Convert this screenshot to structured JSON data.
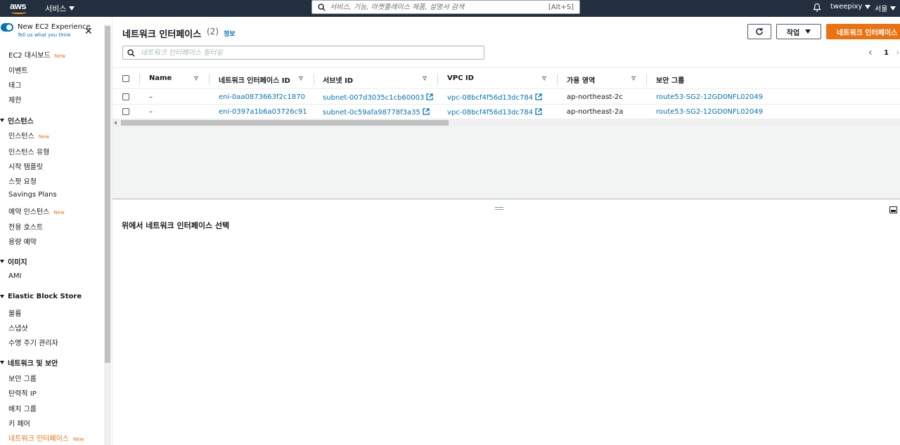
{
  "topnav": {
    "logo": "aws",
    "services_label": "서비스",
    "search_placeholder": "서비스, 기능, 마켓플레이스 제품, 설명서 검색",
    "search_shortcut": "[Alt+S]",
    "user": "tweepixy",
    "region": "서울"
  },
  "sidebar": {
    "experience_title": "New EC2 Experience",
    "experience_sub": "Tell us what you think",
    "new_badge": "New",
    "items": [
      {
        "label": "EC2 대시보드",
        "new": true
      },
      {
        "label": "이벤트"
      },
      {
        "label": "태그"
      },
      {
        "label": "제한"
      }
    ],
    "sections": {
      "instances": {
        "title": "인스턴스",
        "items": [
          "인스턴스",
          "인스턴스 유형",
          "시작 템플릿",
          "스팟 요청",
          "Savings Plans",
          "예약 인스턴스",
          "전용 호스트",
          "용량 예약"
        ]
      },
      "images": {
        "title": "이미지",
        "items": [
          "AMI"
        ]
      },
      "ebs": {
        "title": "Elastic Block Store",
        "items": [
          "볼륨",
          "스냅샷",
          "수명 주기 관리자"
        ]
      },
      "network": {
        "title": "네트워크 및 보안",
        "items": [
          "보안 그룹",
          "탄력적 IP",
          "배치 그룹",
          "키 페어",
          "네트워크 인터페이스"
        ]
      }
    }
  },
  "main": {
    "title": "네트워크 인터페이스",
    "count": "(2)",
    "info": "정보",
    "actions_label": "작업",
    "create_label": "네트워크 인터페이스 생성",
    "filter_placeholder": "네트워크 인터페이스 필터링",
    "page": "1",
    "columns": [
      "Name",
      "네트워크 인터페이스 ID",
      "서브넷 ID",
      "VPC ID",
      "가용 영역",
      "보안 그룹"
    ],
    "rows": [
      {
        "name": "–",
        "eni": "eni-0aa0873663f2c1870",
        "subnet": "subnet-007d3035c1cb60003",
        "vpc": "vpc-08bcf4f56d13dc784",
        "az": "ap-northeast-2c",
        "sg": "route53-SG2-12GD0NFL02049"
      },
      {
        "name": "–",
        "eni": "eni-0397a1b6a03726c91",
        "subnet": "subnet-0c59afa98778f3a35",
        "vpc": "vpc-08bcf4f56d13dc784",
        "az": "ap-northeast-2a",
        "sg": "route53-SG2-12GD0NFL02049"
      }
    ],
    "detail_message": "위에서 네트워크 인터페이스 선택"
  }
}
